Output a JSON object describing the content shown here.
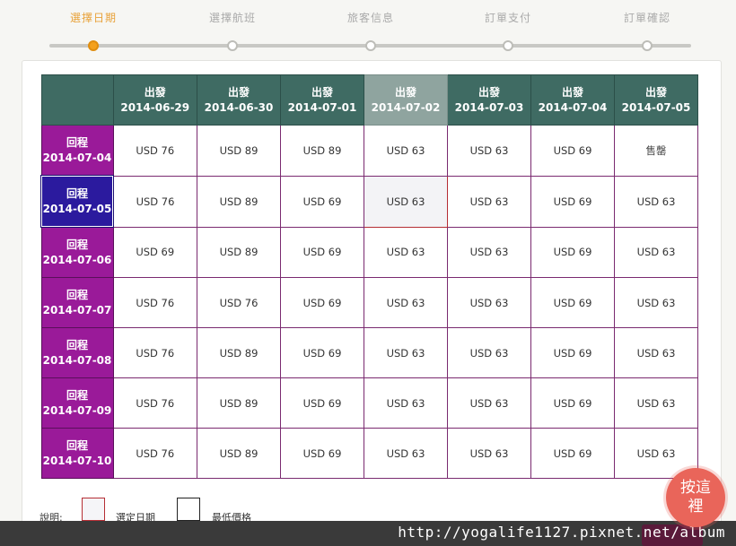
{
  "steps": [
    {
      "label": "選擇日期",
      "active": true
    },
    {
      "label": "選擇航班",
      "active": false
    },
    {
      "label": "旅客信息",
      "active": false
    },
    {
      "label": "訂單支付",
      "active": false
    },
    {
      "label": "訂單確認",
      "active": false
    }
  ],
  "grid": {
    "departure_prefix": "出發",
    "return_prefix": "回程",
    "departures": [
      "2014-06-29",
      "2014-06-30",
      "2014-07-01",
      "2014-07-02",
      "2014-07-03",
      "2014-07-04",
      "2014-07-05"
    ],
    "selected_departure_index": 3,
    "selected_return_index": 1,
    "rows": [
      {
        "return_date": "2014-07-04",
        "prices": [
          "USD 76",
          "USD 89",
          "USD 89",
          "USD 63",
          "USD 63",
          "USD 69",
          "售罄"
        ]
      },
      {
        "return_date": "2014-07-05",
        "prices": [
          "USD 76",
          "USD 89",
          "USD 69",
          "USD 63",
          "USD 63",
          "USD 69",
          "USD 63"
        ]
      },
      {
        "return_date": "2014-07-06",
        "prices": [
          "USD 69",
          "USD 89",
          "USD 69",
          "USD 63",
          "USD 63",
          "USD 69",
          "USD 63"
        ]
      },
      {
        "return_date": "2014-07-07",
        "prices": [
          "USD 76",
          "USD 76",
          "USD 69",
          "USD 63",
          "USD 63",
          "USD 69",
          "USD 63"
        ]
      },
      {
        "return_date": "2014-07-08",
        "prices": [
          "USD 76",
          "USD 89",
          "USD 69",
          "USD 63",
          "USD 63",
          "USD 69",
          "USD 63"
        ]
      },
      {
        "return_date": "2014-07-09",
        "prices": [
          "USD 76",
          "USD 89",
          "USD 69",
          "USD 63",
          "USD 63",
          "USD 69",
          "USD 63"
        ]
      },
      {
        "return_date": "2014-07-10",
        "prices": [
          "USD 76",
          "USD 89",
          "USD 69",
          "USD 63",
          "USD 63",
          "USD 69",
          "USD 63"
        ]
      }
    ]
  },
  "legend": {
    "title": "說明:",
    "selected_label": "選定日期",
    "lowest_label": "最低價格"
  },
  "badge": {
    "text": "按這裡"
  },
  "watermark": {
    "text": "http://yogalife1127.pixnet.net/album"
  },
  "colors": {
    "accent": "#f4a11e",
    "header_bg": "#3f6b63",
    "return_bg": "#9a1a99",
    "selected_return_bg": "#2b1a9e",
    "selected_border": "#b52d34"
  }
}
